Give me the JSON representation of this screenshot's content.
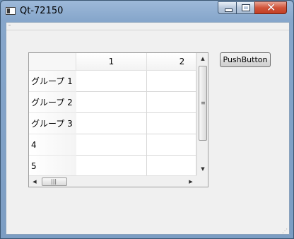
{
  "window": {
    "title": "Qt-72150",
    "controls": {
      "minimize_icon": "minimize-icon",
      "maximize_icon": "maximize-icon",
      "close_icon": "close-icon"
    }
  },
  "table": {
    "columns": [
      "1",
      "2"
    ],
    "rows": [
      "グループ 1",
      "グループ 2",
      "グループ 3",
      "4",
      "5"
    ]
  },
  "button": {
    "label": "PushButton"
  }
}
